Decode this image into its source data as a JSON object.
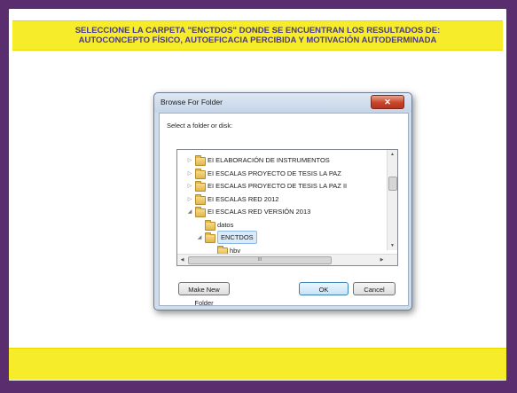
{
  "banner": {
    "line1": "SELECCIONE LA CARPETA \"ENCTDOS\" DONDE SE ENCUENTRAN LOS RESULTADOS DE:",
    "line2": "AUTOCONCEPTO FÍSICO, AUTOEFICACIA PERCIBIDA Y MOTIVACIÓN AUTODERMINADA"
  },
  "dialog": {
    "title": "Browse For Folder",
    "close_glyph": "✕",
    "prompt": "Select a folder or disk:",
    "tree": [
      {
        "label": "EI ELABORACIÓN DE INSTRUMENTOS",
        "arrow": "▷",
        "level": 0,
        "selected": false
      },
      {
        "label": "EI ESCALAS PROYECTO DE TESIS LA PAZ",
        "arrow": "▷",
        "level": 0,
        "selected": false
      },
      {
        "label": "EI ESCALAS PROYECTO DE TESIS LA PAZ II",
        "arrow": "▷",
        "level": 0,
        "selected": false
      },
      {
        "label": "EI ESCALAS RED 2012",
        "arrow": "▷",
        "level": 0,
        "selected": false
      },
      {
        "label": "EI ESCALAS RED VERSIÓN 2013",
        "arrow": "◢",
        "level": 0,
        "selected": false
      },
      {
        "label": "datos",
        "arrow": "",
        "level": 1,
        "selected": false
      },
      {
        "label": "ENCTDOS",
        "arrow": "◢",
        "level": 1,
        "selected": true
      },
      {
        "label": "hbv",
        "arrow": "",
        "level": 2,
        "selected": false
      }
    ],
    "hscroll_grip": "III",
    "scroll_up": "▲",
    "scroll_down": "▼",
    "scroll_left": "◀",
    "scroll_right": "▶",
    "make_new_folder": "Make New Folder",
    "ok": "OK",
    "cancel": "Cancel"
  }
}
